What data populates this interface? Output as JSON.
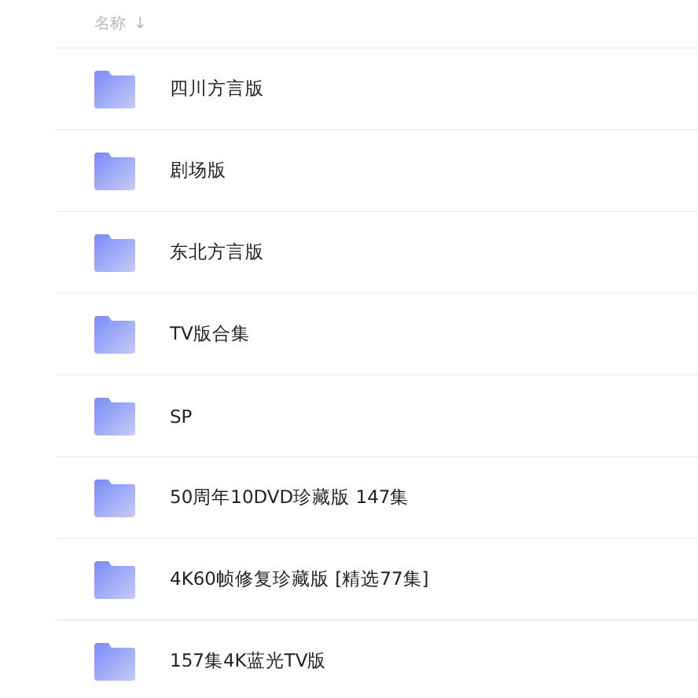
{
  "header": {
    "name_column": "名称",
    "sort_icon": "↓"
  },
  "folders": [
    {
      "name": "四川方言版"
    },
    {
      "name": "剧场版"
    },
    {
      "name": "东北方言版"
    },
    {
      "name": "TV版合集"
    },
    {
      "name": "SP"
    },
    {
      "name": "50周年10DVD珍藏版 147集"
    },
    {
      "name": "4K60帧修复珍藏版 [精选77集]"
    },
    {
      "name": "157集4K蓝光TV版"
    }
  ]
}
